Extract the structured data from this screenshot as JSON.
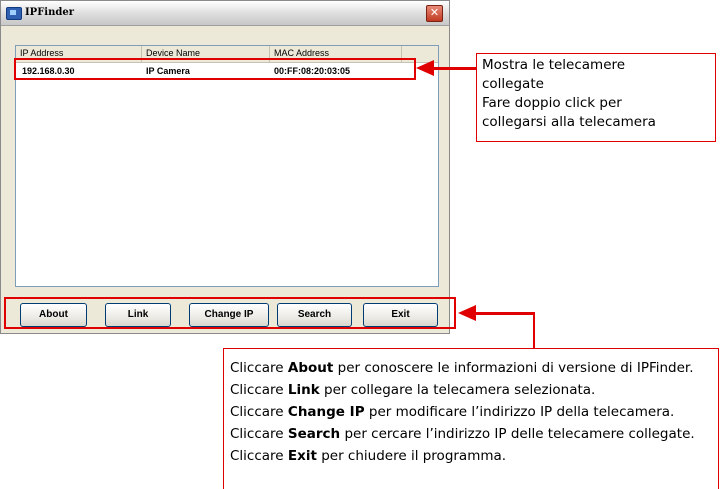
{
  "window": {
    "title": "IPFinder",
    "close_glyph": "✕"
  },
  "list": {
    "columns": [
      "IP Address",
      "Device Name",
      "MAC Address"
    ],
    "rows": [
      {
        "ip": "192.168.0.30",
        "device": "IP Camera",
        "mac": "00:FF:08:20:03:05"
      }
    ]
  },
  "buttons": {
    "about": "About",
    "link": "Link",
    "change_ip": "Change IP",
    "search": "Search",
    "exit": "Exit"
  },
  "annotations": {
    "list_note": [
      "Mostra le telecamere",
      "collegate",
      "Fare doppio click per",
      "collegarsi alla telecamera"
    ],
    "buttons_note": [
      {
        "pre": "Cliccare ",
        "bold": "About",
        "post": " per conoscere le informazioni di versione di IPFinder."
      },
      {
        "pre": "Cliccare ",
        "bold": "Link",
        "post": " per collegare la telecamera selezionata."
      },
      {
        "pre": "Cliccare ",
        "bold": "Change IP",
        "post": " per modificare l’indirizzo IP della telecamera."
      },
      {
        "pre": "Cliccare ",
        "bold": "Search",
        "post": " per cercare l’indirizzo IP delle telecamere collegate."
      },
      {
        "pre": "Cliccare ",
        "bold": "Exit",
        "post": " per chiudere il programma."
      }
    ],
    "highlight_color": "#e00000"
  },
  "icons": {
    "app": "ipfinder-app-icon",
    "close": "close-icon"
  }
}
